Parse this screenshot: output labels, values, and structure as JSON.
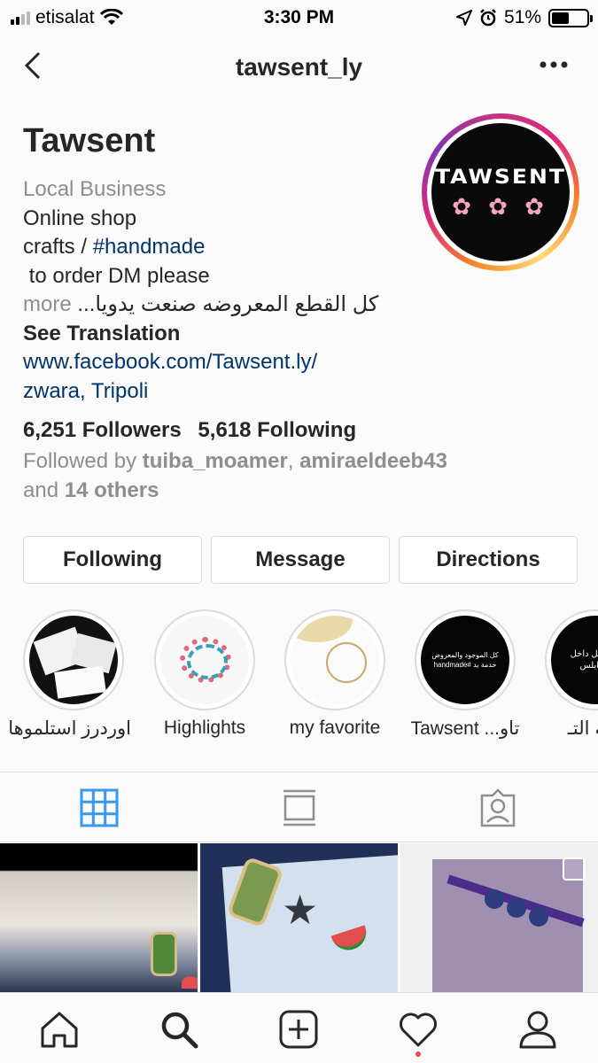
{
  "status_bar": {
    "carrier": "etisalat",
    "time": "3:30 PM",
    "battery": "51%"
  },
  "header": {
    "username": "tawsent_ly"
  },
  "profile": {
    "name": "Tawsent",
    "avatar_text": "TAWSENT",
    "category": "Local Business",
    "bio_line1": "Online shop",
    "bio_line2_prefix": "crafts / ",
    "bio_line2_tag": "#handmade",
    "bio_line3": " to order DM please",
    "bio_line4_more": "more",
    "bio_line4_text": "كل القطع المعروضه صنعت يدويا...",
    "see_translation": "See Translation",
    "website": "www.facebook.com/Tawsent.ly/",
    "location": "zwara, Tripoli",
    "followers": "6,251 Followers",
    "following": "5,618 Following",
    "followed_by_prefix": "Followed by ",
    "followed_user1": "tuiba_moamer",
    "followed_sep": ", ",
    "followed_user2": "amiraeldeeb43",
    "followed_and": "and ",
    "followed_others": "14 others"
  },
  "buttons": {
    "following": "Following",
    "message": "Message",
    "directions": "Directions"
  },
  "highlights": [
    {
      "label": "اوردرز استلموها"
    },
    {
      "label": "Highlights"
    },
    {
      "label": "my favorite"
    },
    {
      "label": "Tawsent ...تاو",
      "story_text": "كل الموجود والمعروض خدمة يد #handmade"
    },
    {
      "label": "دمة التـ",
      "story_text": "التوصيل داخل طرابلس"
    }
  ],
  "colors": {
    "link": "#003569",
    "muted": "#8e8e8e",
    "active_tab": "#3897f0",
    "notif": "#ed4956"
  },
  "icons": {
    "tabs": [
      "grid-icon",
      "feed-icon",
      "tagged-icon"
    ],
    "nav": [
      "home-icon",
      "search-icon",
      "add-post-icon",
      "activity-heart-icon",
      "profile-icon"
    ]
  }
}
